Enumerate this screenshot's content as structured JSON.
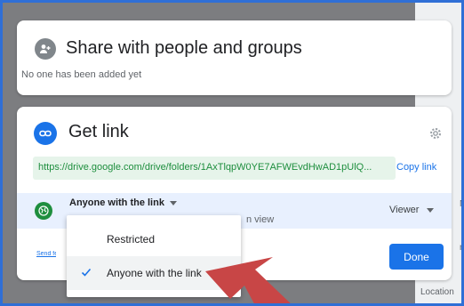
{
  "share_card": {
    "title": "Share with people and groups",
    "subtitle": "No one has been added yet"
  },
  "link_card": {
    "title": "Get link",
    "url": "https://drive.google.com/drive/folders/1AxTlqpW0YE7AFWEvdHwAD1pUlQ...",
    "copy_label": "Copy link",
    "access_label": "Anyone with the link",
    "access_description": "n view",
    "role_label": "Viewer",
    "feedback_label": "Send feedback",
    "done_label": "Done"
  },
  "access_menu": {
    "items": [
      {
        "label": "Restricted",
        "selected": false
      },
      {
        "label": "Anyone with the link",
        "selected": true
      }
    ]
  },
  "side_panel": {
    "location_label": "Location",
    "fragments": [
      "na",
      "N",
      "m"
    ]
  },
  "colors": {
    "accent": "#1a73e8",
    "link_green": "#1e8e3e",
    "annotation_arrow": "#c84646"
  },
  "icons": {
    "share_icon": "person-add-icon",
    "link_icon": "link-icon",
    "settings_icon": "gear-icon",
    "access_icon": "globe-icon",
    "check_icon": "checkmark-icon"
  }
}
